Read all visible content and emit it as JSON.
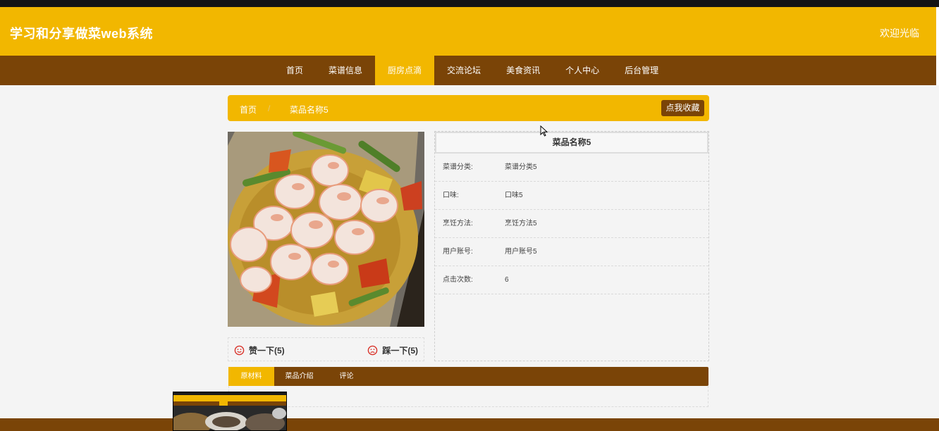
{
  "header": {
    "site_title": "学习和分享做菜web系统",
    "welcome": "欢迎光临"
  },
  "nav": {
    "items": [
      {
        "label": "首页"
      },
      {
        "label": "菜谱信息"
      },
      {
        "label": "厨房点滴"
      },
      {
        "label": "交流论坛"
      },
      {
        "label": "美食资讯"
      },
      {
        "label": "个人中心"
      },
      {
        "label": "后台管理"
      }
    ],
    "active": "厨房点滴"
  },
  "breadcrumb": {
    "home": "首页",
    "separator": "/",
    "current": "菜品名称5",
    "favorite_button": "点我收藏"
  },
  "detail": {
    "title": "菜品名称5",
    "rows": [
      {
        "label": "菜谱分类:",
        "value": "菜谱分类5"
      },
      {
        "label": "口味:",
        "value": "口味5"
      },
      {
        "label": "烹饪方法:",
        "value": "烹饪方法5"
      },
      {
        "label": "用户账号:",
        "value": "用户账号5"
      },
      {
        "label": "点击次数:",
        "value": "6"
      }
    ]
  },
  "votes": {
    "like_label": "赞一下(5)",
    "dislike_label": "踩一下(5)"
  },
  "tabs": [
    {
      "label": "原材料"
    },
    {
      "label": "菜品介绍"
    },
    {
      "label": "评论"
    }
  ],
  "colors": {
    "accent": "#f2b700",
    "brown": "#7a4407",
    "vote_icon": "#d9342b"
  }
}
